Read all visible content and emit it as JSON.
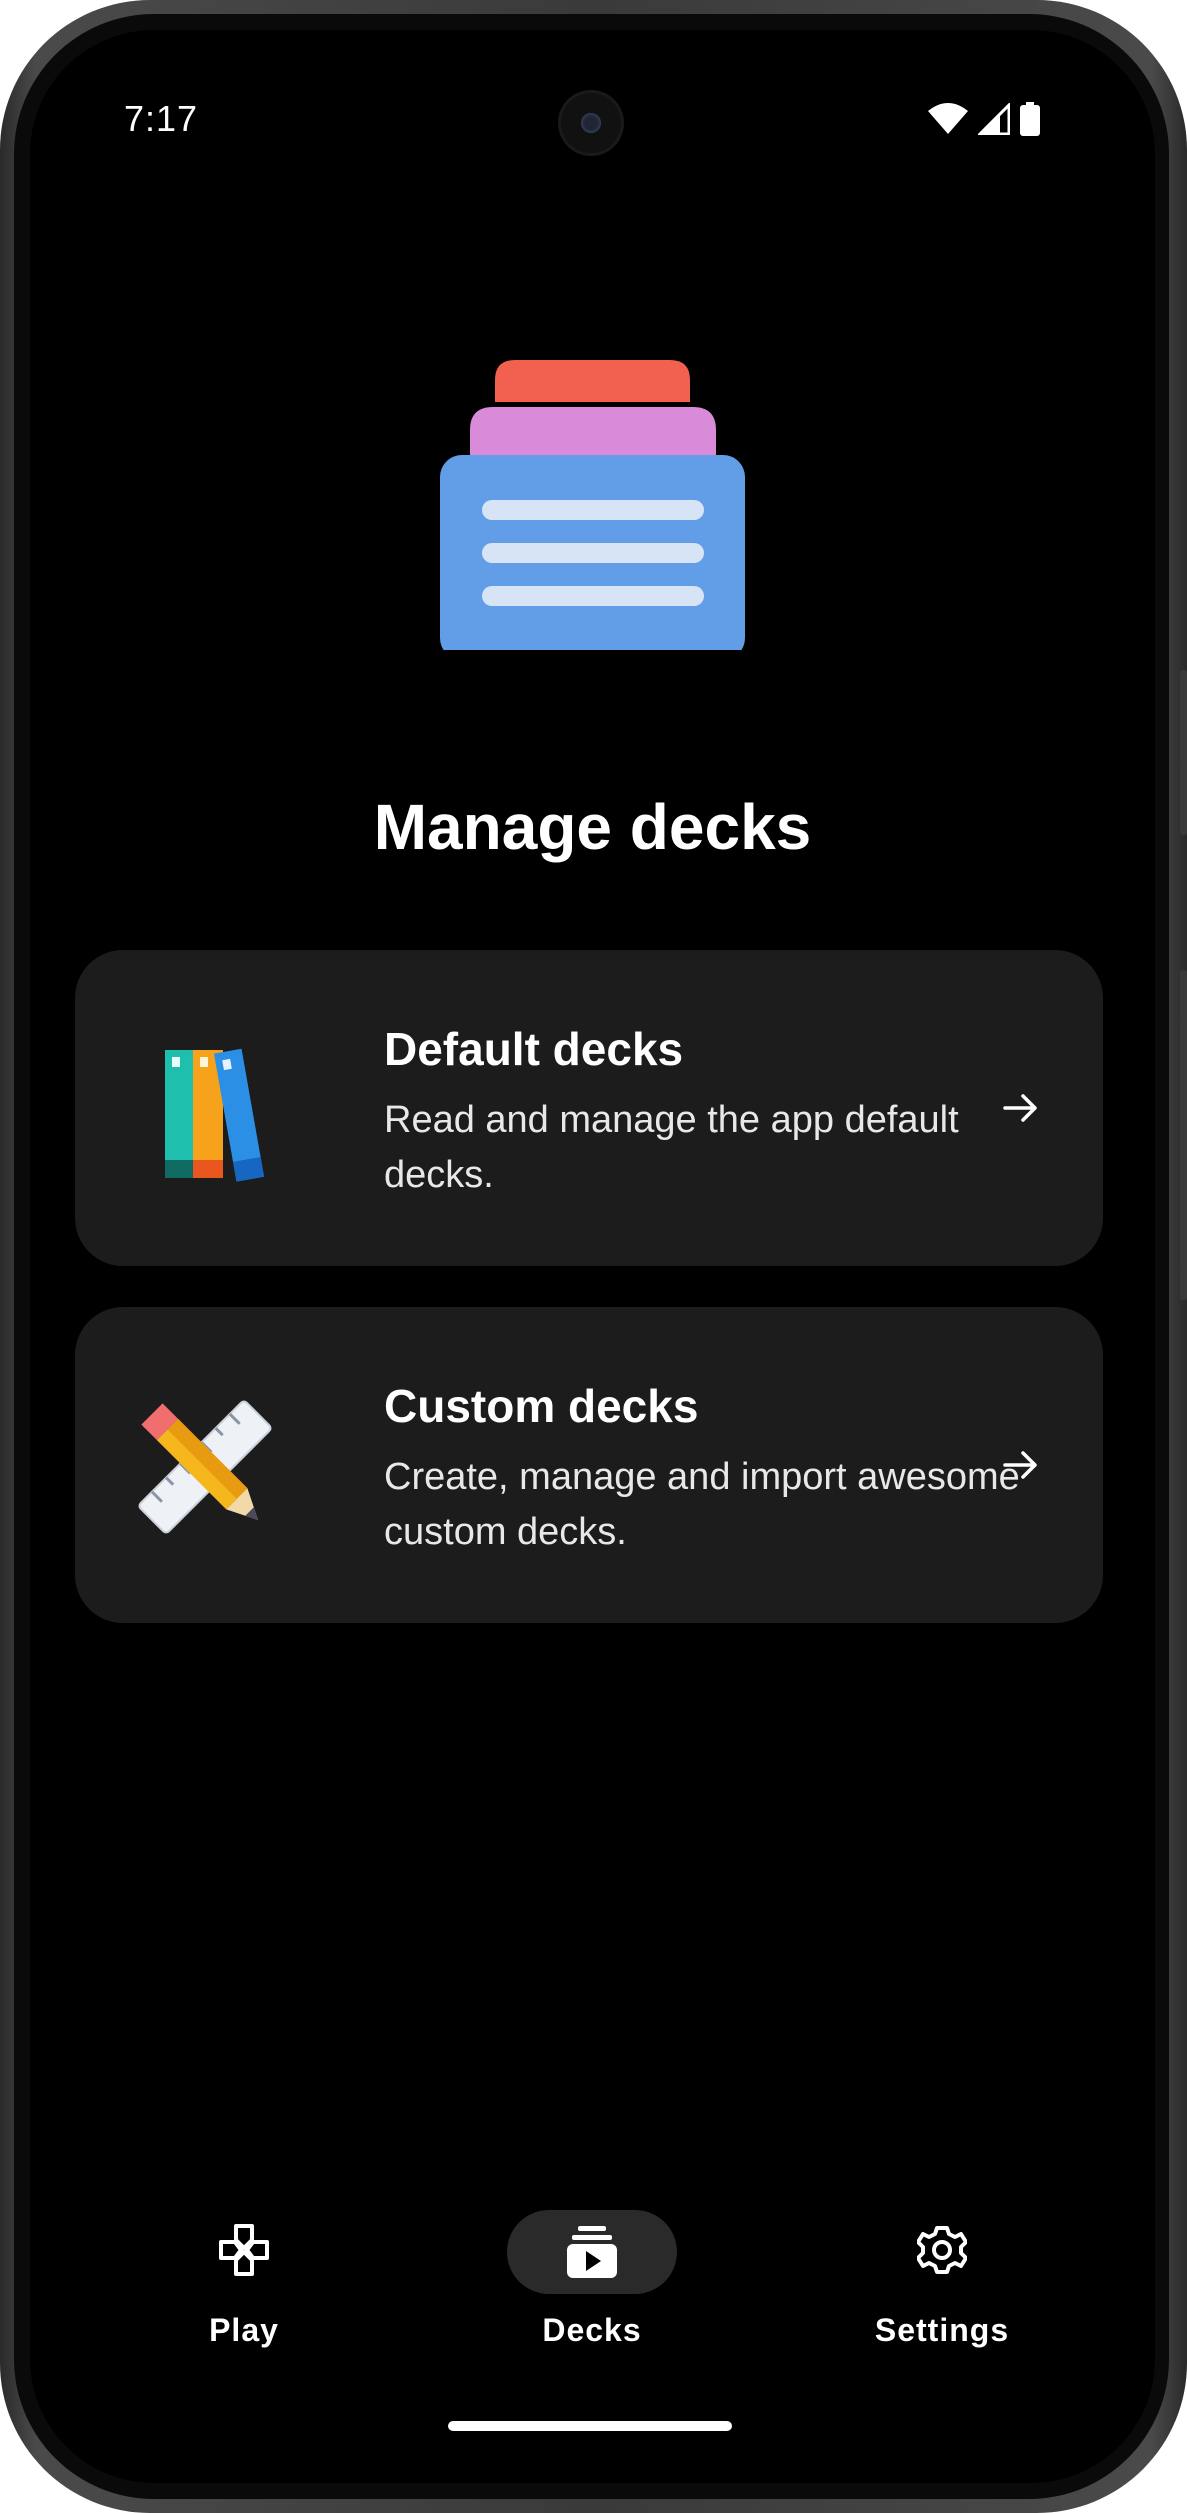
{
  "status_bar": {
    "time": "7:17"
  },
  "page": {
    "title": "Manage decks"
  },
  "cards": [
    {
      "title": "Default decks",
      "description": "Read and manage the app default decks."
    },
    {
      "title": "Custom decks",
      "description": "Create, manage and import awesome custom decks."
    }
  ],
  "bottom_nav": {
    "items": [
      {
        "label": "Play",
        "icon": "gamepad-icon",
        "active": false
      },
      {
        "label": "Decks",
        "icon": "decks-icon",
        "active": true
      },
      {
        "label": "Settings",
        "icon": "gear-icon",
        "active": false
      }
    ]
  },
  "colors": {
    "background": "#000000",
    "card": "#1c1c1c",
    "active_pill": "#2a2a2a",
    "hero_red": "#f2614f",
    "hero_purple": "#d98bd9",
    "hero_blue": "#629ee8",
    "hero_lines": "#d7e4f5"
  }
}
